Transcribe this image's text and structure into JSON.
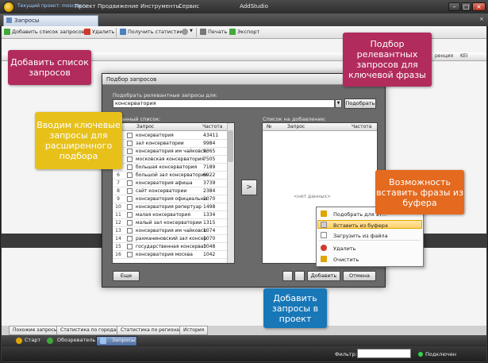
{
  "window": {
    "project_label": "Текущий проект: moscow.ru",
    "title": "AddStudio",
    "menu": [
      "Проект",
      "Продвижение",
      "Инструменты",
      "Сервис"
    ],
    "minimize_label": "–",
    "maximize_label": "□",
    "close_label": "×"
  },
  "doc_tab": {
    "label": "Запросы",
    "close_label": "×"
  },
  "toolbar": {
    "add_label": "Добавить список запросов",
    "delete_label": "Удалить",
    "stats_label": "Получить статистику",
    "print_label": "Печать",
    "export_label": "Экспорт"
  },
  "grid": {
    "visible_columns": [
      "ренция",
      "KEI"
    ]
  },
  "dialog": {
    "title": "Подбор запросов",
    "close_label": "×",
    "combo_label": "Подобрать релевантные запросы для:",
    "combo_value": "консерватория",
    "combo_arrow": "▼",
    "pick_button": "Подобрать",
    "found_label": "...данный список:",
    "found_columns": {
      "num": "№",
      "query": "Запрос",
      "freq": "Частота"
    },
    "found_rows": [
      {
        "num": "1",
        "query": "консерватория",
        "freq": "43411"
      },
      {
        "num": "2",
        "query": "зал консерватории",
        "freq": "9984"
      },
      {
        "num": "3",
        "query": "консерватория им чайковского",
        "freq": "9365"
      },
      {
        "num": "4",
        "query": "московская консерватория",
        "freq": "7505"
      },
      {
        "num": "5",
        "query": "большая консерватория",
        "freq": "7189"
      },
      {
        "num": "6",
        "query": "большой зал консерватории",
        "freq": "6922"
      },
      {
        "num": "7",
        "query": "консерватория афиша",
        "freq": "3739"
      },
      {
        "num": "8",
        "query": "сайт консерватории",
        "freq": "2384"
      },
      {
        "num": "9",
        "query": "консерватория официальный",
        "freq": "2070"
      },
      {
        "num": "10",
        "query": "консерватория репертуар",
        "freq": "1498"
      },
      {
        "num": "11",
        "query": "малая консерватория",
        "freq": "1334"
      },
      {
        "num": "12",
        "query": "малый зал консерватории",
        "freq": "1315"
      },
      {
        "num": "13",
        "query": "консерватория им чайковского",
        "freq": "1074"
      },
      {
        "num": "14",
        "query": "рахманиновский зал консерв.",
        "freq": "1070"
      },
      {
        "num": "15",
        "query": "государственная консервато",
        "freq": "1048"
      },
      {
        "num": "16",
        "query": "консерватория москва",
        "freq": "1042"
      }
    ],
    "move_button": ">",
    "add_label": "Список на добавление:",
    "add_columns": {
      "num": "№",
      "query": "Запрос",
      "freq": "Частота"
    },
    "no_data": "<нет данных>",
    "context_menu": [
      {
        "label": "Подобрать для эт..."
      },
      {
        "label": "Вставить из буфера"
      },
      {
        "label": "Загрузить из файла"
      },
      {
        "label": "Удалить"
      },
      {
        "label": "Очистить"
      }
    ],
    "history_button": "Еще",
    "add_button": "Добавить",
    "cancel_button": "Отмена"
  },
  "bottom_tabs": [
    "Похожие запросы",
    "Статистика по городам",
    "Статистика по регионам",
    "История"
  ],
  "nav_tabs": [
    "Старт",
    "Обозреватель",
    "Запросы"
  ],
  "status": {
    "filter_label": "Фильтр:",
    "connection": "Подключен"
  },
  "callouts": {
    "add_list": "Добавить список запросов",
    "pick": "Подбор релевантных запросов для ключевой фразы",
    "keywords": "Вводим ключевые запросы для расширенного подбора",
    "paste": "Возможность вставить фразы из буфера",
    "add_project": "Добавить запросы в проект"
  },
  "colors": {
    "callout_magenta": "#b12b5c",
    "callout_yellow": "#e7c11a",
    "callout_orange": "#e46a1f",
    "callout_blue": "#1877b7",
    "status_ok": "#34d34a"
  }
}
